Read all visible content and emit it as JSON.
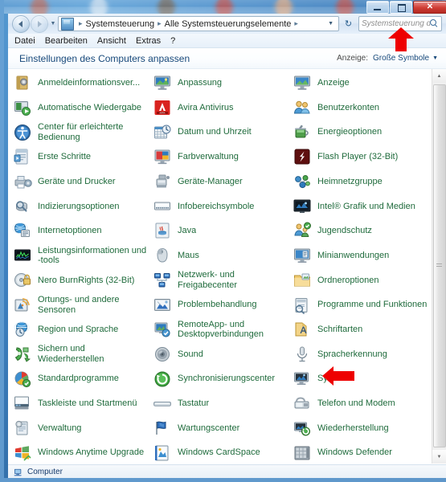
{
  "window": {
    "caption_buttons": {
      "minimize_label": "",
      "maximize_label": "",
      "close_label": "✕"
    }
  },
  "addressbar": {
    "back_tooltip": "Zurück",
    "forward_tooltip": "Vorwärts",
    "breadcrumbs": [
      "Systemsteuerung",
      "Alle Systemsteuerungselemente"
    ],
    "separator": "▸",
    "dropdown_caret": "▼",
    "refresh_glyph": "↻",
    "search_placeholder": "Systemsteuerung durchs..."
  },
  "menubar": {
    "items": [
      "Datei",
      "Bearbeiten",
      "Ansicht",
      "Extras",
      "?"
    ]
  },
  "content_header": {
    "title": "Einstellungen des Computers anpassen",
    "view_label": "Anzeige:",
    "view_value": "Große Symbole",
    "view_caret": "▼"
  },
  "colors": {
    "link_green": "#1f6b3c",
    "title_blue": "#17487a",
    "annotation_red": "#ee0000"
  },
  "items": [
    {
      "label": "Anmeldeinformationsver...",
      "icon": "credential-manager-icon"
    },
    {
      "label": "Anpassung",
      "icon": "personalization-icon"
    },
    {
      "label": "Anzeige",
      "icon": "display-icon"
    },
    {
      "label": "Automatische Wiedergabe",
      "icon": "autoplay-icon"
    },
    {
      "label": "Avira Antivirus",
      "icon": "avira-icon"
    },
    {
      "label": "Benutzerkonten",
      "icon": "user-accounts-icon"
    },
    {
      "label": "Center für erleichterte Bedienung",
      "icon": "ease-of-access-icon"
    },
    {
      "label": "Datum und Uhrzeit",
      "icon": "date-time-icon"
    },
    {
      "label": "Energieoptionen",
      "icon": "power-options-icon"
    },
    {
      "label": "Erste Schritte",
      "icon": "getting-started-icon"
    },
    {
      "label": "Farbverwaltung",
      "icon": "color-management-icon"
    },
    {
      "label": "Flash Player (32-Bit)",
      "icon": "flash-player-icon"
    },
    {
      "label": "Geräte und Drucker",
      "icon": "devices-printers-icon"
    },
    {
      "label": "Geräte-Manager",
      "icon": "device-manager-icon"
    },
    {
      "label": "Heimnetzgruppe",
      "icon": "homegroup-icon"
    },
    {
      "label": "Indizierungsoptionen",
      "icon": "indexing-options-icon"
    },
    {
      "label": "Infobereichsymbole",
      "icon": "notification-area-icon"
    },
    {
      "label": "Intel® Grafik und Medien",
      "icon": "intel-graphics-icon"
    },
    {
      "label": "Internetoptionen",
      "icon": "internet-options-icon"
    },
    {
      "label": "Java",
      "icon": "java-icon"
    },
    {
      "label": "Jugendschutz",
      "icon": "parental-controls-icon"
    },
    {
      "label": "Leistungsinformationen und -tools",
      "icon": "performance-info-icon"
    },
    {
      "label": "Maus",
      "icon": "mouse-icon"
    },
    {
      "label": "Minianwendungen",
      "icon": "gadgets-icon"
    },
    {
      "label": "Nero BurnRights (32-Bit)",
      "icon": "nero-burnrights-icon"
    },
    {
      "label": "Netzwerk- und Freigabecenter",
      "icon": "network-sharing-icon"
    },
    {
      "label": "Ordneroptionen",
      "icon": "folder-options-icon"
    },
    {
      "label": "Ortungs- und andere Sensoren",
      "icon": "location-sensors-icon"
    },
    {
      "label": "Problembehandlung",
      "icon": "troubleshooting-icon"
    },
    {
      "label": "Programme und Funktionen",
      "icon": "programs-features-icon"
    },
    {
      "label": "Region und Sprache",
      "icon": "region-language-icon"
    },
    {
      "label": "RemoteApp- und Desktopverbindungen",
      "icon": "remoteapp-icon"
    },
    {
      "label": "Schriftarten",
      "icon": "fonts-icon"
    },
    {
      "label": "Sichern und Wiederherstellen",
      "icon": "backup-restore-icon"
    },
    {
      "label": "Sound",
      "icon": "sound-icon"
    },
    {
      "label": "Spracherkennung",
      "icon": "speech-recognition-icon"
    },
    {
      "label": "Standardprogramme",
      "icon": "default-programs-icon"
    },
    {
      "label": "Synchronisierungscenter",
      "icon": "sync-center-icon"
    },
    {
      "label": "System",
      "icon": "system-icon"
    },
    {
      "label": "Taskleiste und Startmenü",
      "icon": "taskbar-startmenu-icon"
    },
    {
      "label": "Tastatur",
      "icon": "keyboard-icon"
    },
    {
      "label": "Telefon und Modem",
      "icon": "phone-modem-icon"
    },
    {
      "label": "Verwaltung",
      "icon": "administrative-tools-icon"
    },
    {
      "label": "Wartungscenter",
      "icon": "action-center-icon"
    },
    {
      "label": "Wiederherstellung",
      "icon": "recovery-icon"
    },
    {
      "label": "Windows Anytime Upgrade",
      "icon": "anytime-upgrade-icon"
    },
    {
      "label": "Windows CardSpace",
      "icon": "cardspace-icon"
    },
    {
      "label": "Windows Defender",
      "icon": "windows-defender-icon"
    }
  ],
  "statusbar": {
    "text": "Computer"
  },
  "annotations": [
    {
      "name": "arrow-pointing-to-search-box",
      "direction": "up"
    },
    {
      "name": "arrow-pointing-to-system",
      "direction": "left"
    }
  ]
}
